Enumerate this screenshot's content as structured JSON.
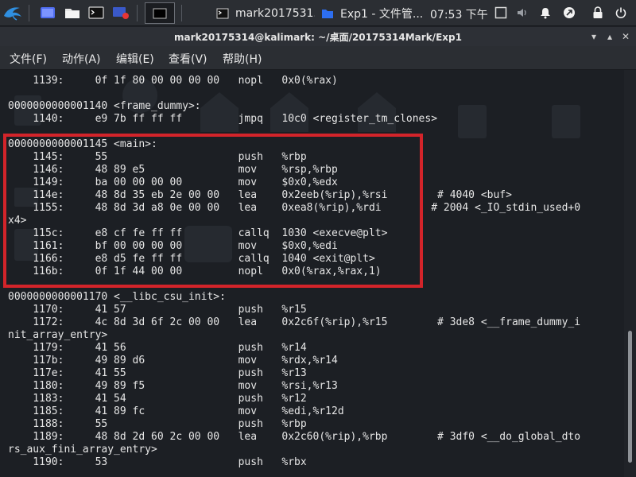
{
  "taskbar": {
    "tasks": [
      {
        "label": "mark2017531..."
      },
      {
        "label": "Exp1 - 文件管..."
      }
    ],
    "clock": "07:53 下午"
  },
  "window": {
    "title": "mark20175314@kalimark: ~/桌面/20175314Mark/Exp1"
  },
  "menu": [
    "文件(F)",
    "动作(A)",
    "编辑(E)",
    "查看(V)",
    "帮助(H)"
  ],
  "terminal": {
    "lines": [
      "    1139:\t0f 1f 80 00 00 00 00 \tnopl   0x0(%rax)",
      "",
      "0000000000001140 <frame_dummy>:",
      "    1140:\te9 7b ff ff ff       \tjmpq   10c0 <register_tm_clones>",
      "",
      "0000000000001145 <main>:",
      "    1145:\t55                   \tpush   %rbp",
      "    1146:\t48 89 e5             \tmov    %rsp,%rbp",
      "    1149:\tba 00 00 00 00       \tmov    $0x0,%edx",
      "    114e:\t48 8d 35 eb 2e 00 00 \tlea    0x2eeb(%rip),%rsi        # 4040 <buf>",
      "    1155:\t48 8d 3d a8 0e 00 00 \tlea    0xea8(%rip),%rdi        # 2004 <_IO_stdin_used+0",
      "x4>",
      "    115c:\te8 cf fe ff ff       \tcallq  1030 <execve@plt>",
      "    1161:\tbf 00 00 00 00       \tmov    $0x0,%edi",
      "    1166:\te8 d5 fe ff ff       \tcallq  1040 <exit@plt>",
      "    116b:\t0f 1f 44 00 00       \tnopl   0x0(%rax,%rax,1)",
      "",
      "0000000000001170 <__libc_csu_init>:",
      "    1170:\t41 57                \tpush   %r15",
      "    1172:\t4c 8d 3d 6f 2c 00 00 \tlea    0x2c6f(%rip),%r15        # 3de8 <__frame_dummy_i",
      "nit_array_entry>",
      "    1179:\t41 56                \tpush   %r14",
      "    117b:\t49 89 d6             \tmov    %rdx,%r14",
      "    117e:\t41 55                \tpush   %r13",
      "    1180:\t49 89 f5             \tmov    %rsi,%r13",
      "    1183:\t41 54                \tpush   %r12",
      "    1185:\t41 89 fc             \tmov    %edi,%r12d",
      "    1188:\t55                   \tpush   %rbp",
      "    1189:\t48 8d 2d 60 2c 00 00 \tlea    0x2c60(%rip),%rbp        # 3df0 <__do_global_dto",
      "rs_aux_fini_array_entry>",
      "    1190:\t53                   \tpush   %rbx"
    ]
  },
  "colors": {
    "terminal_bg": "#1c1f24",
    "terminal_fg": "#e6e6e6",
    "highlight_border": "#d3242a",
    "panel_bg": "#2b2e33"
  }
}
